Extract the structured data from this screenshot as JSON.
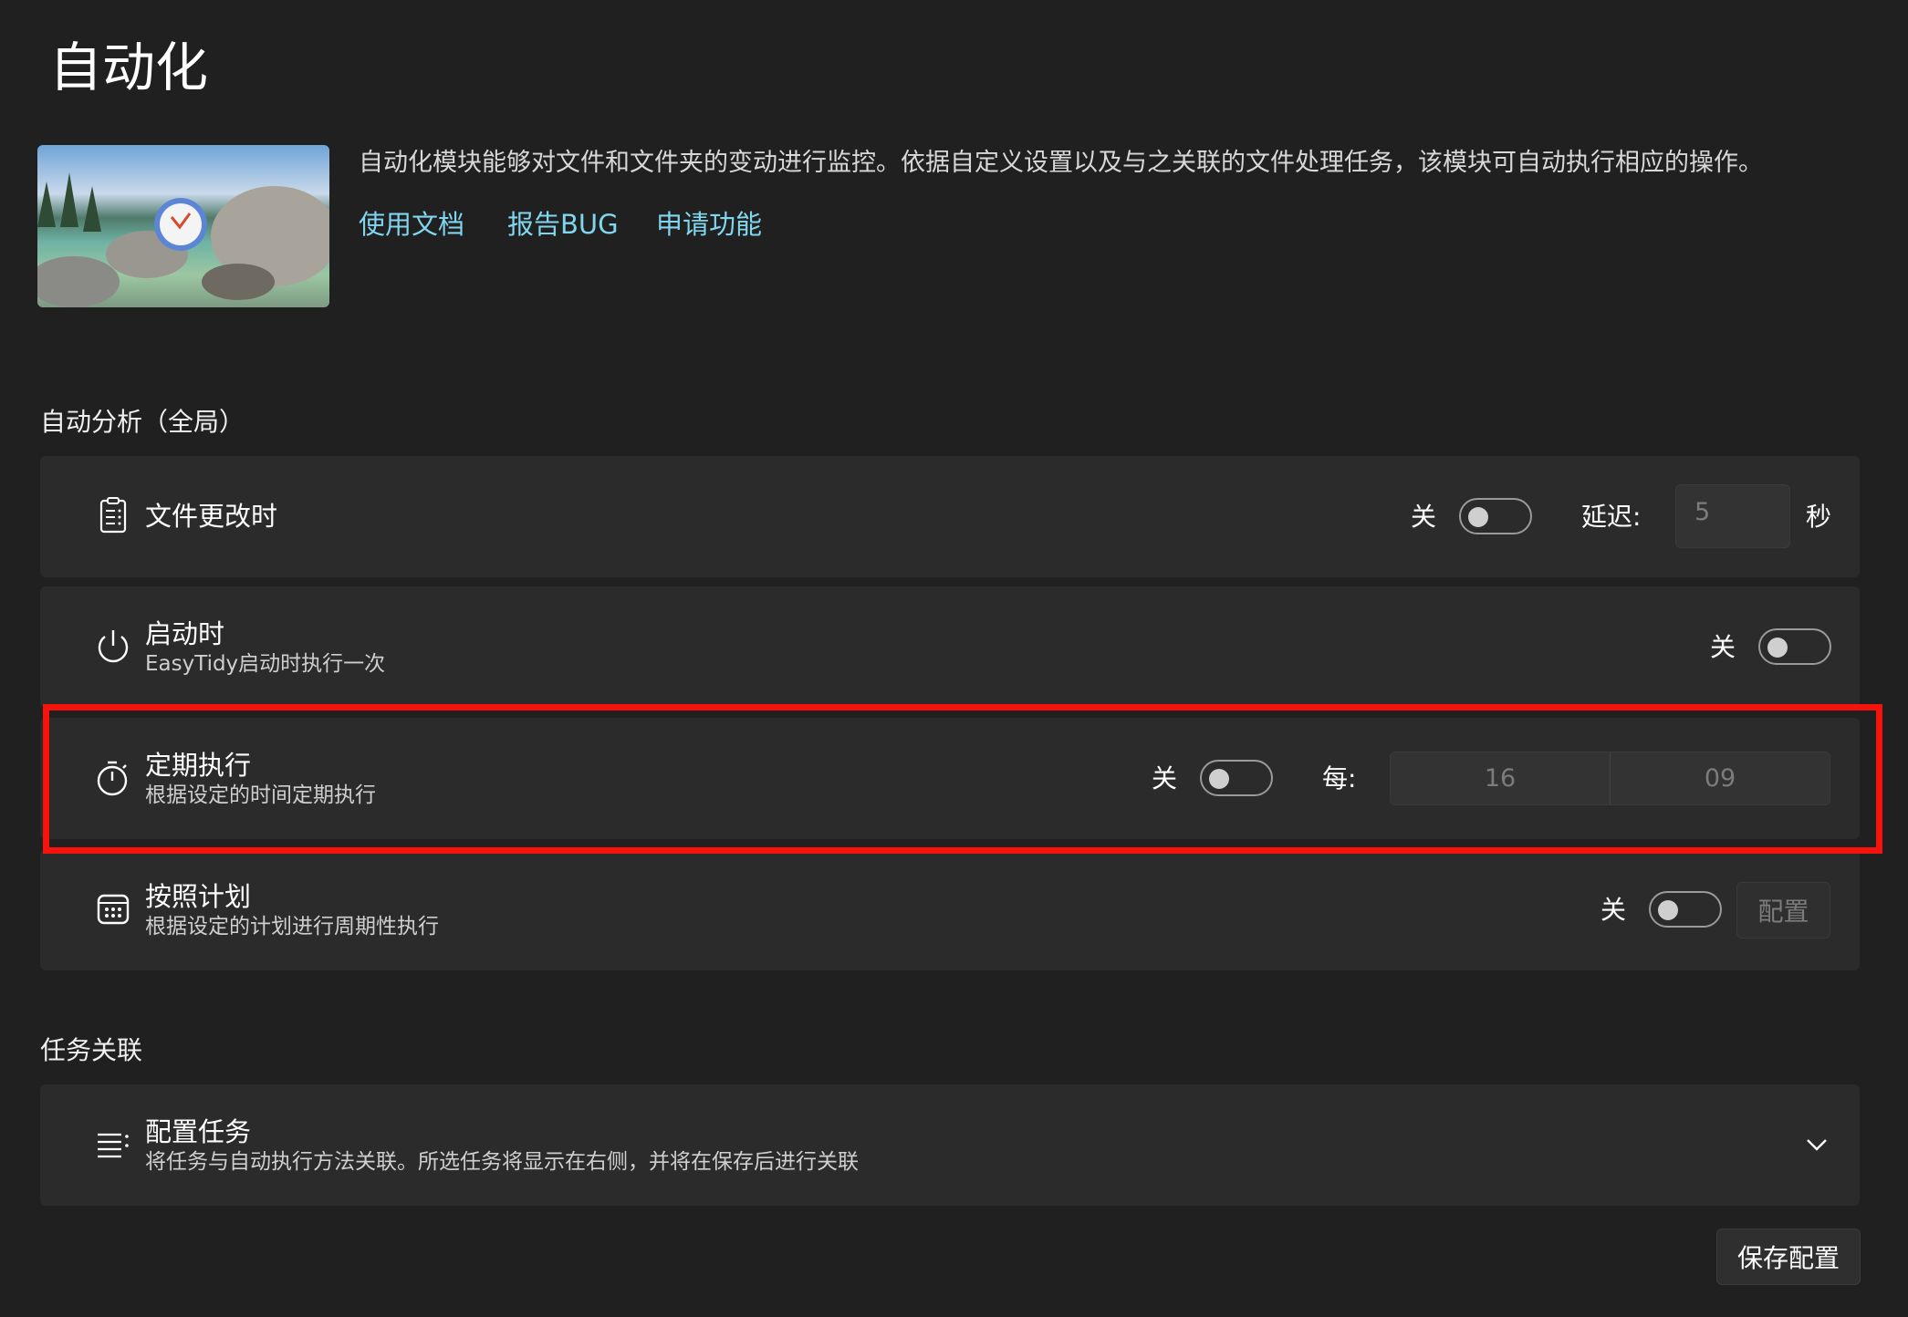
{
  "page": {
    "title": "自动化"
  },
  "intro": {
    "description": "自动化模块能够对文件和文件夹的变动进行监控。依据自定义设置以及与之关联的文件处理任务，该模块可自动执行相应的操作。",
    "links": [
      "使用文档",
      "报告BUG",
      "申请功能"
    ],
    "image_icon": "clock-icon"
  },
  "auto_analysis": {
    "section_title": "自动分析（全局）",
    "file_change": {
      "title": "文件更改时",
      "icon": "clipboard-list-icon",
      "toggle_label": "关",
      "toggle_on": false,
      "delay_label": "延迟:",
      "delay_value": "5",
      "delay_unit": "秒"
    },
    "on_startup": {
      "title": "启动时",
      "subtitle": "EasyTidy启动时执行一次",
      "icon": "power-icon",
      "toggle_label": "关",
      "toggle_on": false
    },
    "scheduled": {
      "title": "定期执行",
      "subtitle": "根据设定的时间定期执行",
      "icon": "timer-icon",
      "toggle_label": "关",
      "toggle_on": false,
      "every_label": "每:",
      "hour": "16",
      "minute": "09"
    },
    "by_plan": {
      "title": "按照计划",
      "subtitle": "根据设定的计划进行周期性执行",
      "icon": "calendar-icon",
      "toggle_label": "关",
      "toggle_on": false,
      "config_label": "配置"
    }
  },
  "task_link": {
    "section_title": "任务关联",
    "config_tasks": {
      "title": "配置任务",
      "subtitle": "将任务与自动执行方法关联。所选任务将显示在右侧，并将在保存后进行关联",
      "icon": "list-icon"
    }
  },
  "footer": {
    "save_label": "保存配置"
  },
  "colors": {
    "background": "#202020",
    "card": "#2b2b2b",
    "link": "#7fd6ee",
    "highlight": "#f5130c"
  }
}
